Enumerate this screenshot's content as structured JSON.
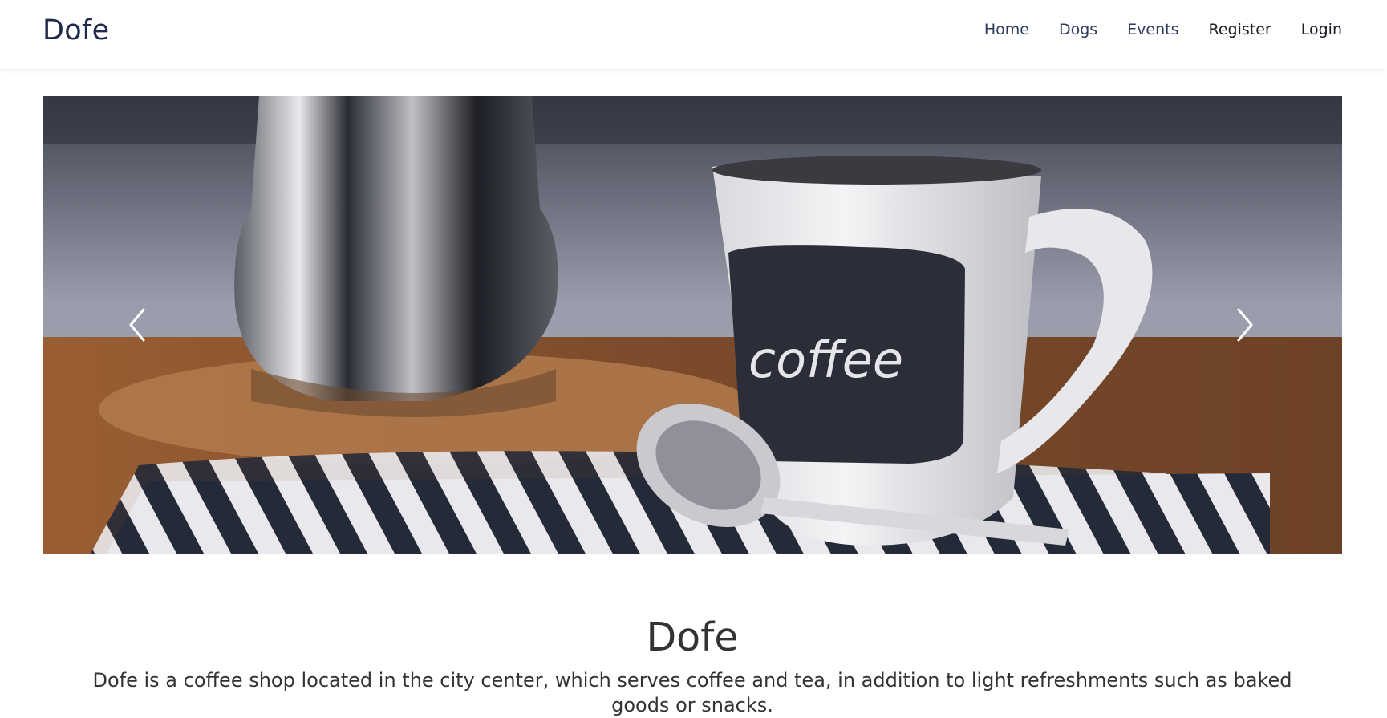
{
  "navbar": {
    "brand": "Dofe",
    "links": [
      {
        "label": "Home"
      },
      {
        "label": "Dogs"
      },
      {
        "label": "Events"
      },
      {
        "label": "Register"
      },
      {
        "label": "Login"
      }
    ]
  },
  "carousel": {
    "image": "coffee-mug-photo",
    "mug_text": "coffee",
    "prev_icon": "chevron-left-icon",
    "next_icon": "chevron-right-icon"
  },
  "intro": {
    "title": "Dofe",
    "description": "Dofe is a coffee shop located in the city center, which serves coffee and tea, in addition to light refreshments such as baked goods or snacks."
  },
  "colors": {
    "brand": "#1f2b4d",
    "nav_link": "#2d3a5e",
    "text": "#333333"
  }
}
